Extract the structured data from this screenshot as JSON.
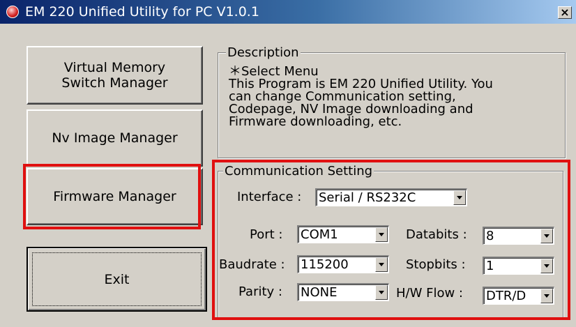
{
  "window": {
    "title": "EM 220 Unified Utility for PC V1.0.1",
    "close_glyph": "×",
    "app_icon": "app-logo-icon"
  },
  "buttons": {
    "virtual_memory": [
      "Virtual Memory",
      "Switch Manager"
    ],
    "nv_image": "Nv Image Manager",
    "firmware": "Firmware Manager",
    "exit": "Exit"
  },
  "description": {
    "legend": "Description",
    "lines": [
      "＊Select Menu",
      " This Program is EM 220 Unified Utility. You",
      "can change Communication setting,",
      "Codepage, NV Image downloading and",
      "Firmware downloading, etc."
    ]
  },
  "communication": {
    "legend": "Communication Setting",
    "interface_label": "Interface :",
    "interface_value": "Serial / RS232C",
    "port_label": "Port :",
    "port_value": "COM1",
    "baudrate_label": "Baudrate :",
    "baudrate_value": "115200",
    "parity_label": "Parity :",
    "parity_value": "NONE",
    "databits_label": "Databits :",
    "databits_value": "8",
    "stopbits_label": "Stopbits :",
    "stopbits_value": "1",
    "hwflow_label": "H/W Flow :",
    "hwflow_value": "DTR/D"
  },
  "colors": {
    "highlight_box": "#e01010",
    "titlebar_start": "#0a246a",
    "titlebar_end": "#a6caf0",
    "face": "#d4d0c8"
  }
}
